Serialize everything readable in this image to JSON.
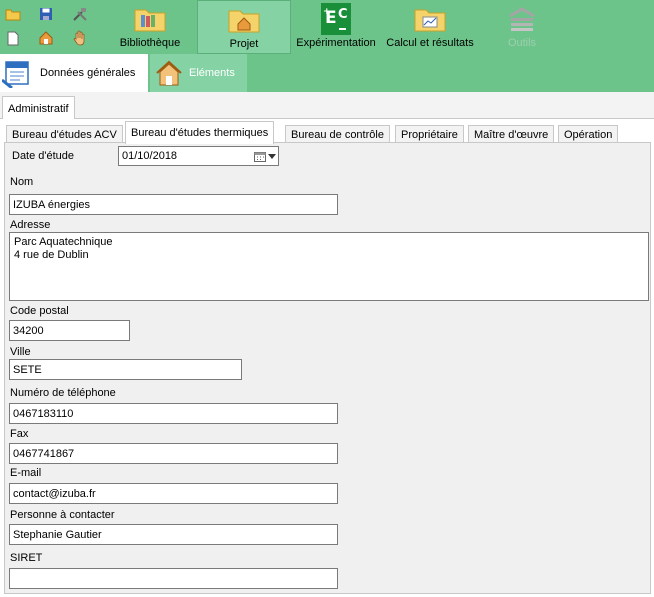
{
  "ribbon": {
    "bibliotheque": "Bibliothèque",
    "projet": "Projet",
    "experimentation": "Expérimentation",
    "calcul": "Calcul et résultats",
    "disabled_button": "Outils"
  },
  "subtabs": {
    "donnees": "Données générales",
    "elements": "Eléments"
  },
  "tabs": {
    "administratif": "Administratif",
    "secondary": [
      "Bureau d'études ACV",
      "Bureau d'études thermiques",
      "Bureau de contrôle",
      "Propriétaire",
      "Maître d'œuvre",
      "Opération"
    ],
    "active_index": 1
  },
  "form": {
    "date_label": "Date d'étude",
    "date_value": "01/10/2018",
    "nom_label": "Nom",
    "nom_value": "IZUBA énergies",
    "adresse_label": "Adresse",
    "adresse_value": "Parc Aquatechnique\n4 rue de Dublin",
    "cp_label": "Code postal",
    "cp_value": "34200",
    "ville_label": "Ville",
    "ville_value": "SETE",
    "tel_label": "Numéro de téléphone",
    "tel_value": "0467183110",
    "fax_label": "Fax",
    "fax_value": "0467741867",
    "email_label": "E-mail",
    "email_value": "contact@izuba.fr",
    "contact_label": "Personne à contacter",
    "contact_value": "Stephanie Gautier",
    "siret_label": "SIRET",
    "siret_value": ""
  },
  "colors": {
    "ribbon": "#6cc48a",
    "ribbon_active": "#85d3a4",
    "panel": "#f0f0f0"
  },
  "icons": [
    "open-folder-icon",
    "save-icon",
    "tools-icon",
    "new-file-icon",
    "home-settings-icon",
    "hand-icon",
    "library-folder-icon",
    "project-folder-icon",
    "experimentation-icon",
    "results-folder-icon",
    "disabled-tool-icon",
    "data-sheet-icon",
    "house-icon",
    "calendar-icon"
  ]
}
